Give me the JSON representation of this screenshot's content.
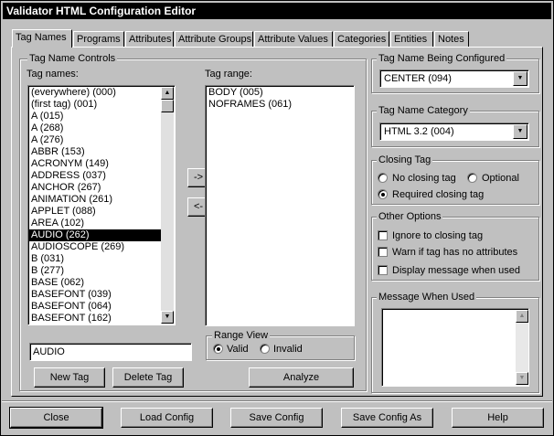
{
  "window": {
    "title": "Validator HTML Configuration Editor"
  },
  "tabs": [
    {
      "label": "Tag Names",
      "active": true
    },
    {
      "label": "Programs"
    },
    {
      "label": "Attributes"
    },
    {
      "label": "Attribute Groups"
    },
    {
      "label": "Attribute Values"
    },
    {
      "label": "Categories"
    },
    {
      "label": "Entities"
    },
    {
      "label": "Notes"
    }
  ],
  "tag_name_controls": {
    "group_title": "Tag Name Controls",
    "tag_names_label": "Tag names:",
    "tag_names": [
      "(everywhere) (000)",
      "(first tag) (001)",
      "A (015)",
      "A (268)",
      "A (276)",
      "ABBR (153)",
      "ACRONYM (149)",
      "ADDRESS (037)",
      "ANCHOR (267)",
      "ANIMATION (261)",
      "APPLET (088)",
      "AREA (102)",
      "AUDIO (262)",
      "AUDIOSCOPE (269)",
      "B (031)",
      "B (277)",
      "BASE (062)",
      "BASEFONT (039)",
      "BASEFONT (064)",
      "BASEFONT (162)"
    ],
    "selected_tag": "AUDIO (262)",
    "add_arrow": "->",
    "remove_arrow": "<-",
    "tag_range_label": "Tag range:",
    "tag_range": [
      "BODY (005)",
      "NOFRAMES (061)"
    ],
    "tag_name_input": "AUDIO",
    "new_tag_button": "New Tag",
    "delete_tag_button": "Delete Tag",
    "range_view": {
      "title": "Range View",
      "valid_label": "Valid",
      "invalid_label": "Invalid",
      "selected": "Valid"
    },
    "analyze_button": "Analyze"
  },
  "tag_being_configured": {
    "title": "Tag Name Being Configured",
    "value": "CENTER (094)"
  },
  "tag_category": {
    "title": "Tag Name Category",
    "value": "HTML 3.2 (004)"
  },
  "closing_tag": {
    "title": "Closing Tag",
    "options": [
      "No closing tag",
      "Optional",
      "Required closing tag"
    ],
    "selected": "Required closing tag"
  },
  "other_options": {
    "title": "Other Options",
    "checkboxes": [
      {
        "label": "Ignore to closing tag",
        "checked": false
      },
      {
        "label": "Warn if tag has no attributes",
        "checked": false
      },
      {
        "label": "Display message when used",
        "checked": false
      }
    ]
  },
  "message_when_used": {
    "title": "Message When Used",
    "value": ""
  },
  "bottom_buttons": {
    "close": "Close",
    "load_config": "Load Config",
    "save_config": "Save Config",
    "save_config_as": "Save Config As",
    "help": "Help"
  }
}
